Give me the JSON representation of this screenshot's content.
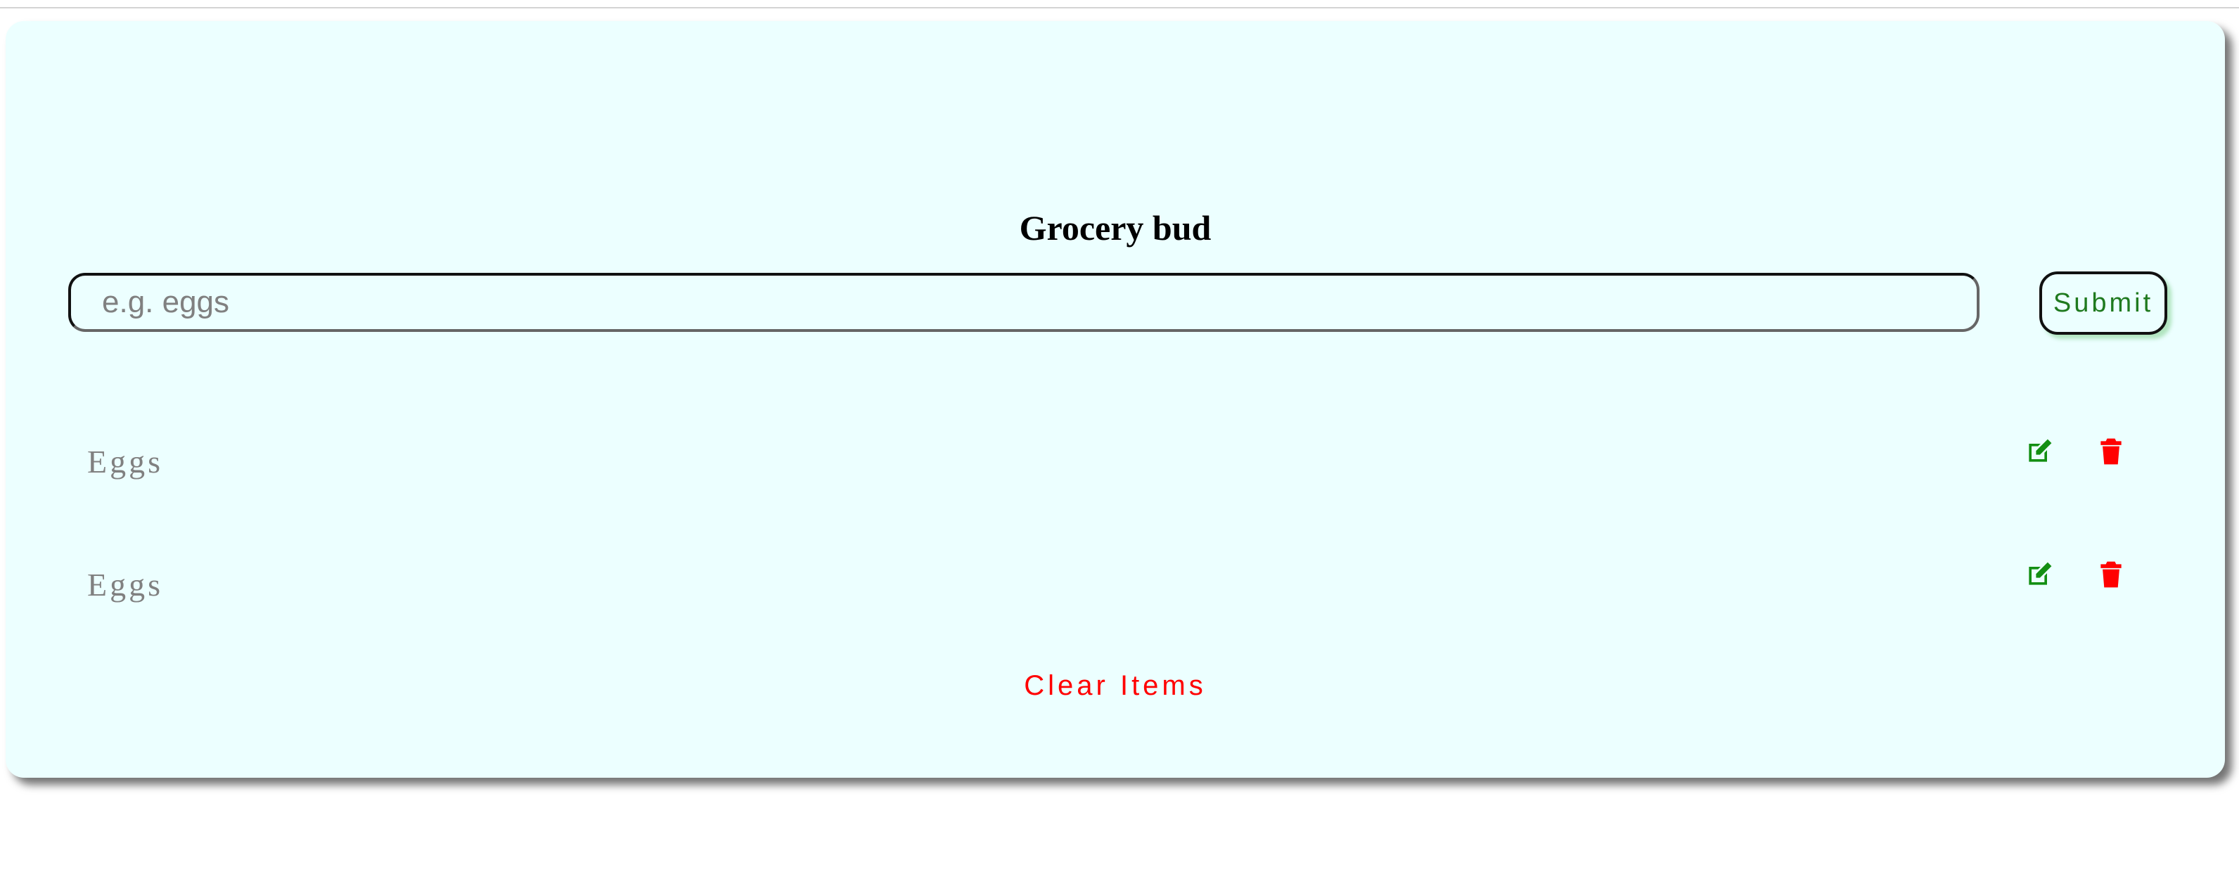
{
  "app": {
    "title": "Grocery bud"
  },
  "form": {
    "input_value": "",
    "input_placeholder": "e.g. eggs",
    "submit_label": "Submit"
  },
  "items": [
    {
      "name": "Eggs",
      "edit_icon": "edit-icon",
      "delete_icon": "trash-icon"
    },
    {
      "name": "Eggs",
      "edit_icon": "edit-icon",
      "delete_icon": "trash-icon"
    }
  ],
  "clear_label": "Clear Items",
  "colors": {
    "card_background": "#ecffff",
    "submit_text": "#1f7a1f",
    "edit_icon": "#138f13",
    "delete_icon": "#ff0000",
    "clear_text": "#ff0000",
    "item_text": "#808080"
  }
}
